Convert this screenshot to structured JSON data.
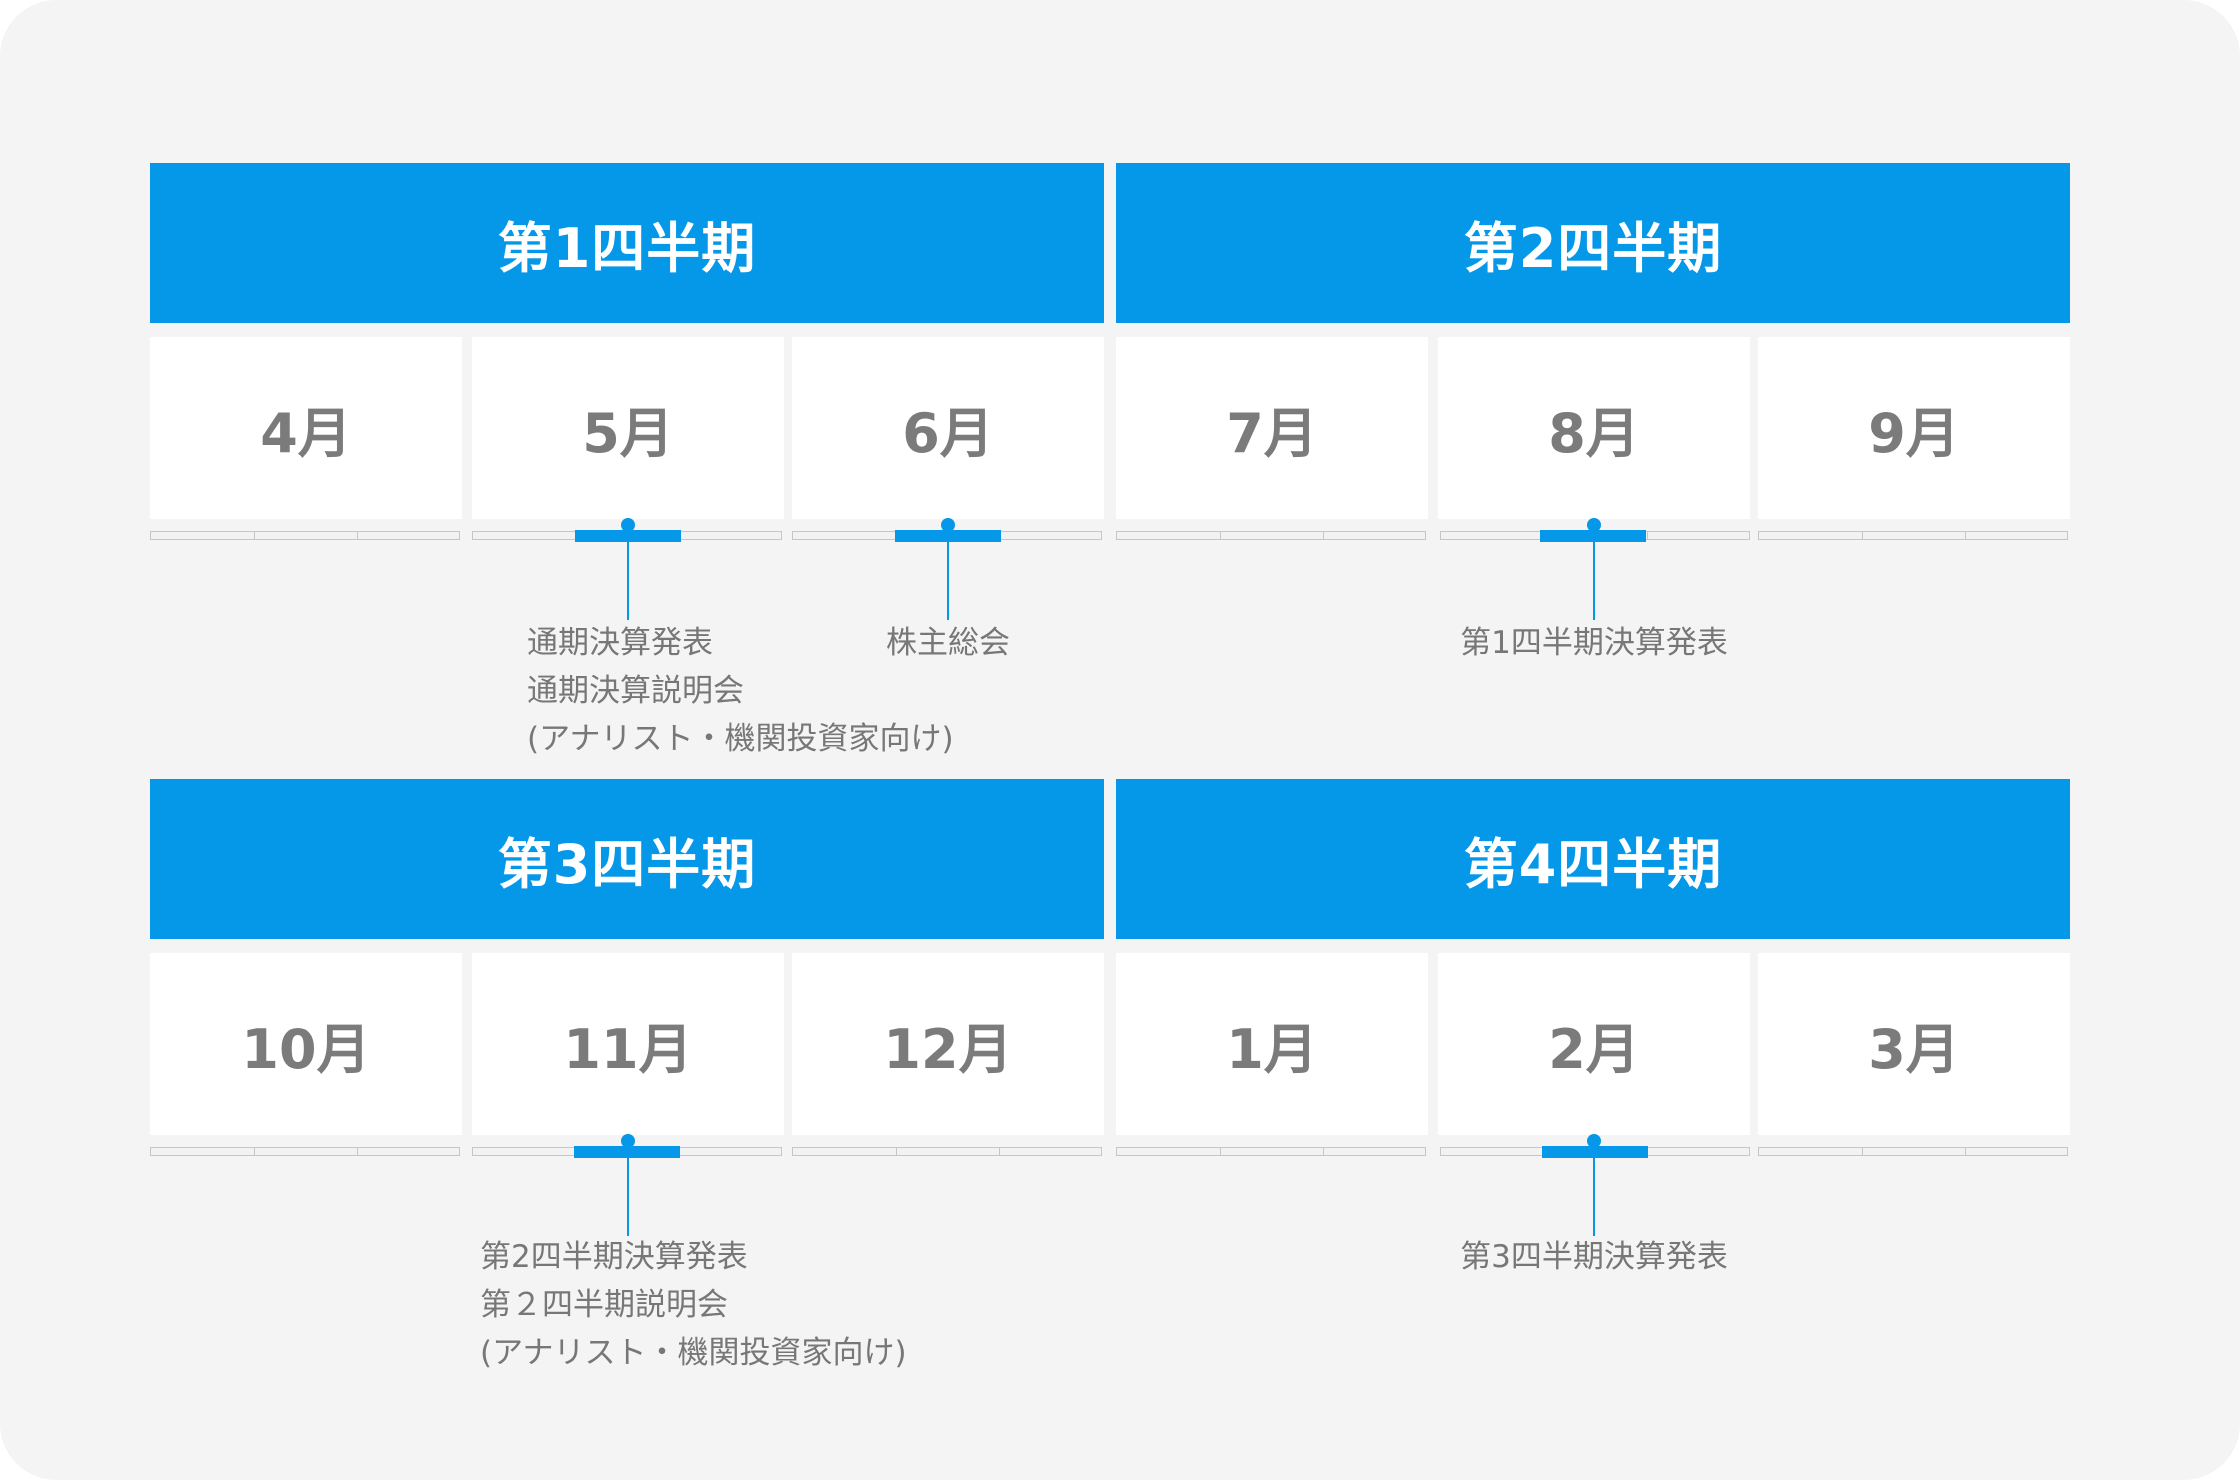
{
  "quarters": [
    {
      "label": "第1四半期",
      "months": [
        "4月",
        "5月",
        "6月"
      ]
    },
    {
      "label": "第2四半期",
      "months": [
        "7月",
        "8月",
        "9月"
      ]
    },
    {
      "label": "第3四半期",
      "months": [
        "10月",
        "11月",
        "12月"
      ]
    },
    {
      "label": "第4四半期",
      "months": [
        "1月",
        "2月",
        "3月"
      ]
    }
  ],
  "events": {
    "may": [
      "通期決算発表",
      "通期決算説明会",
      "(アナリスト・機関投資家向け)"
    ],
    "june": [
      "株主総会"
    ],
    "aug": [
      "第1四半期決算発表"
    ],
    "nov": [
      "第2四半期決算発表",
      "第２四半期説明会",
      "(アナリスト・機関投資家向け)"
    ],
    "feb": [
      "第3四半期決算発表"
    ]
  },
  "colors": {
    "accent": "#0597e8",
    "background": "#f4f4f4",
    "month_text": "#7b7b7b",
    "event_text": "#777777"
  }
}
